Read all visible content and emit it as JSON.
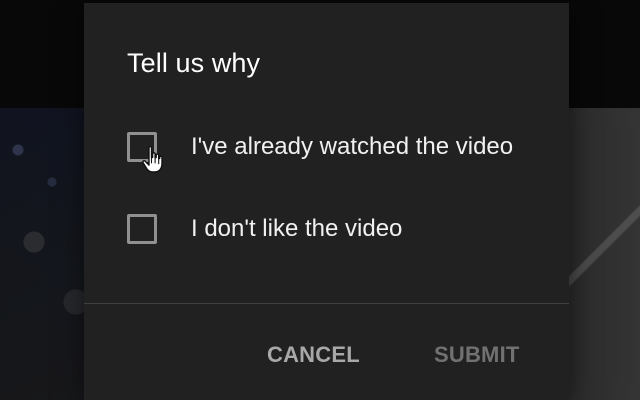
{
  "dialog": {
    "title": "Tell us why",
    "options": [
      {
        "label": "I've already watched the video",
        "checked": false
      },
      {
        "label": "I don't like the video",
        "checked": false
      }
    ],
    "actions": {
      "cancel": "CANCEL",
      "submit": "SUBMIT"
    }
  },
  "pointer": {
    "icon": "hand-pointer-icon"
  },
  "colors": {
    "dialog_background": "#212121",
    "text": "#f1f1f1",
    "checkbox_border": "#909090",
    "disabled_text": "#717171"
  }
}
